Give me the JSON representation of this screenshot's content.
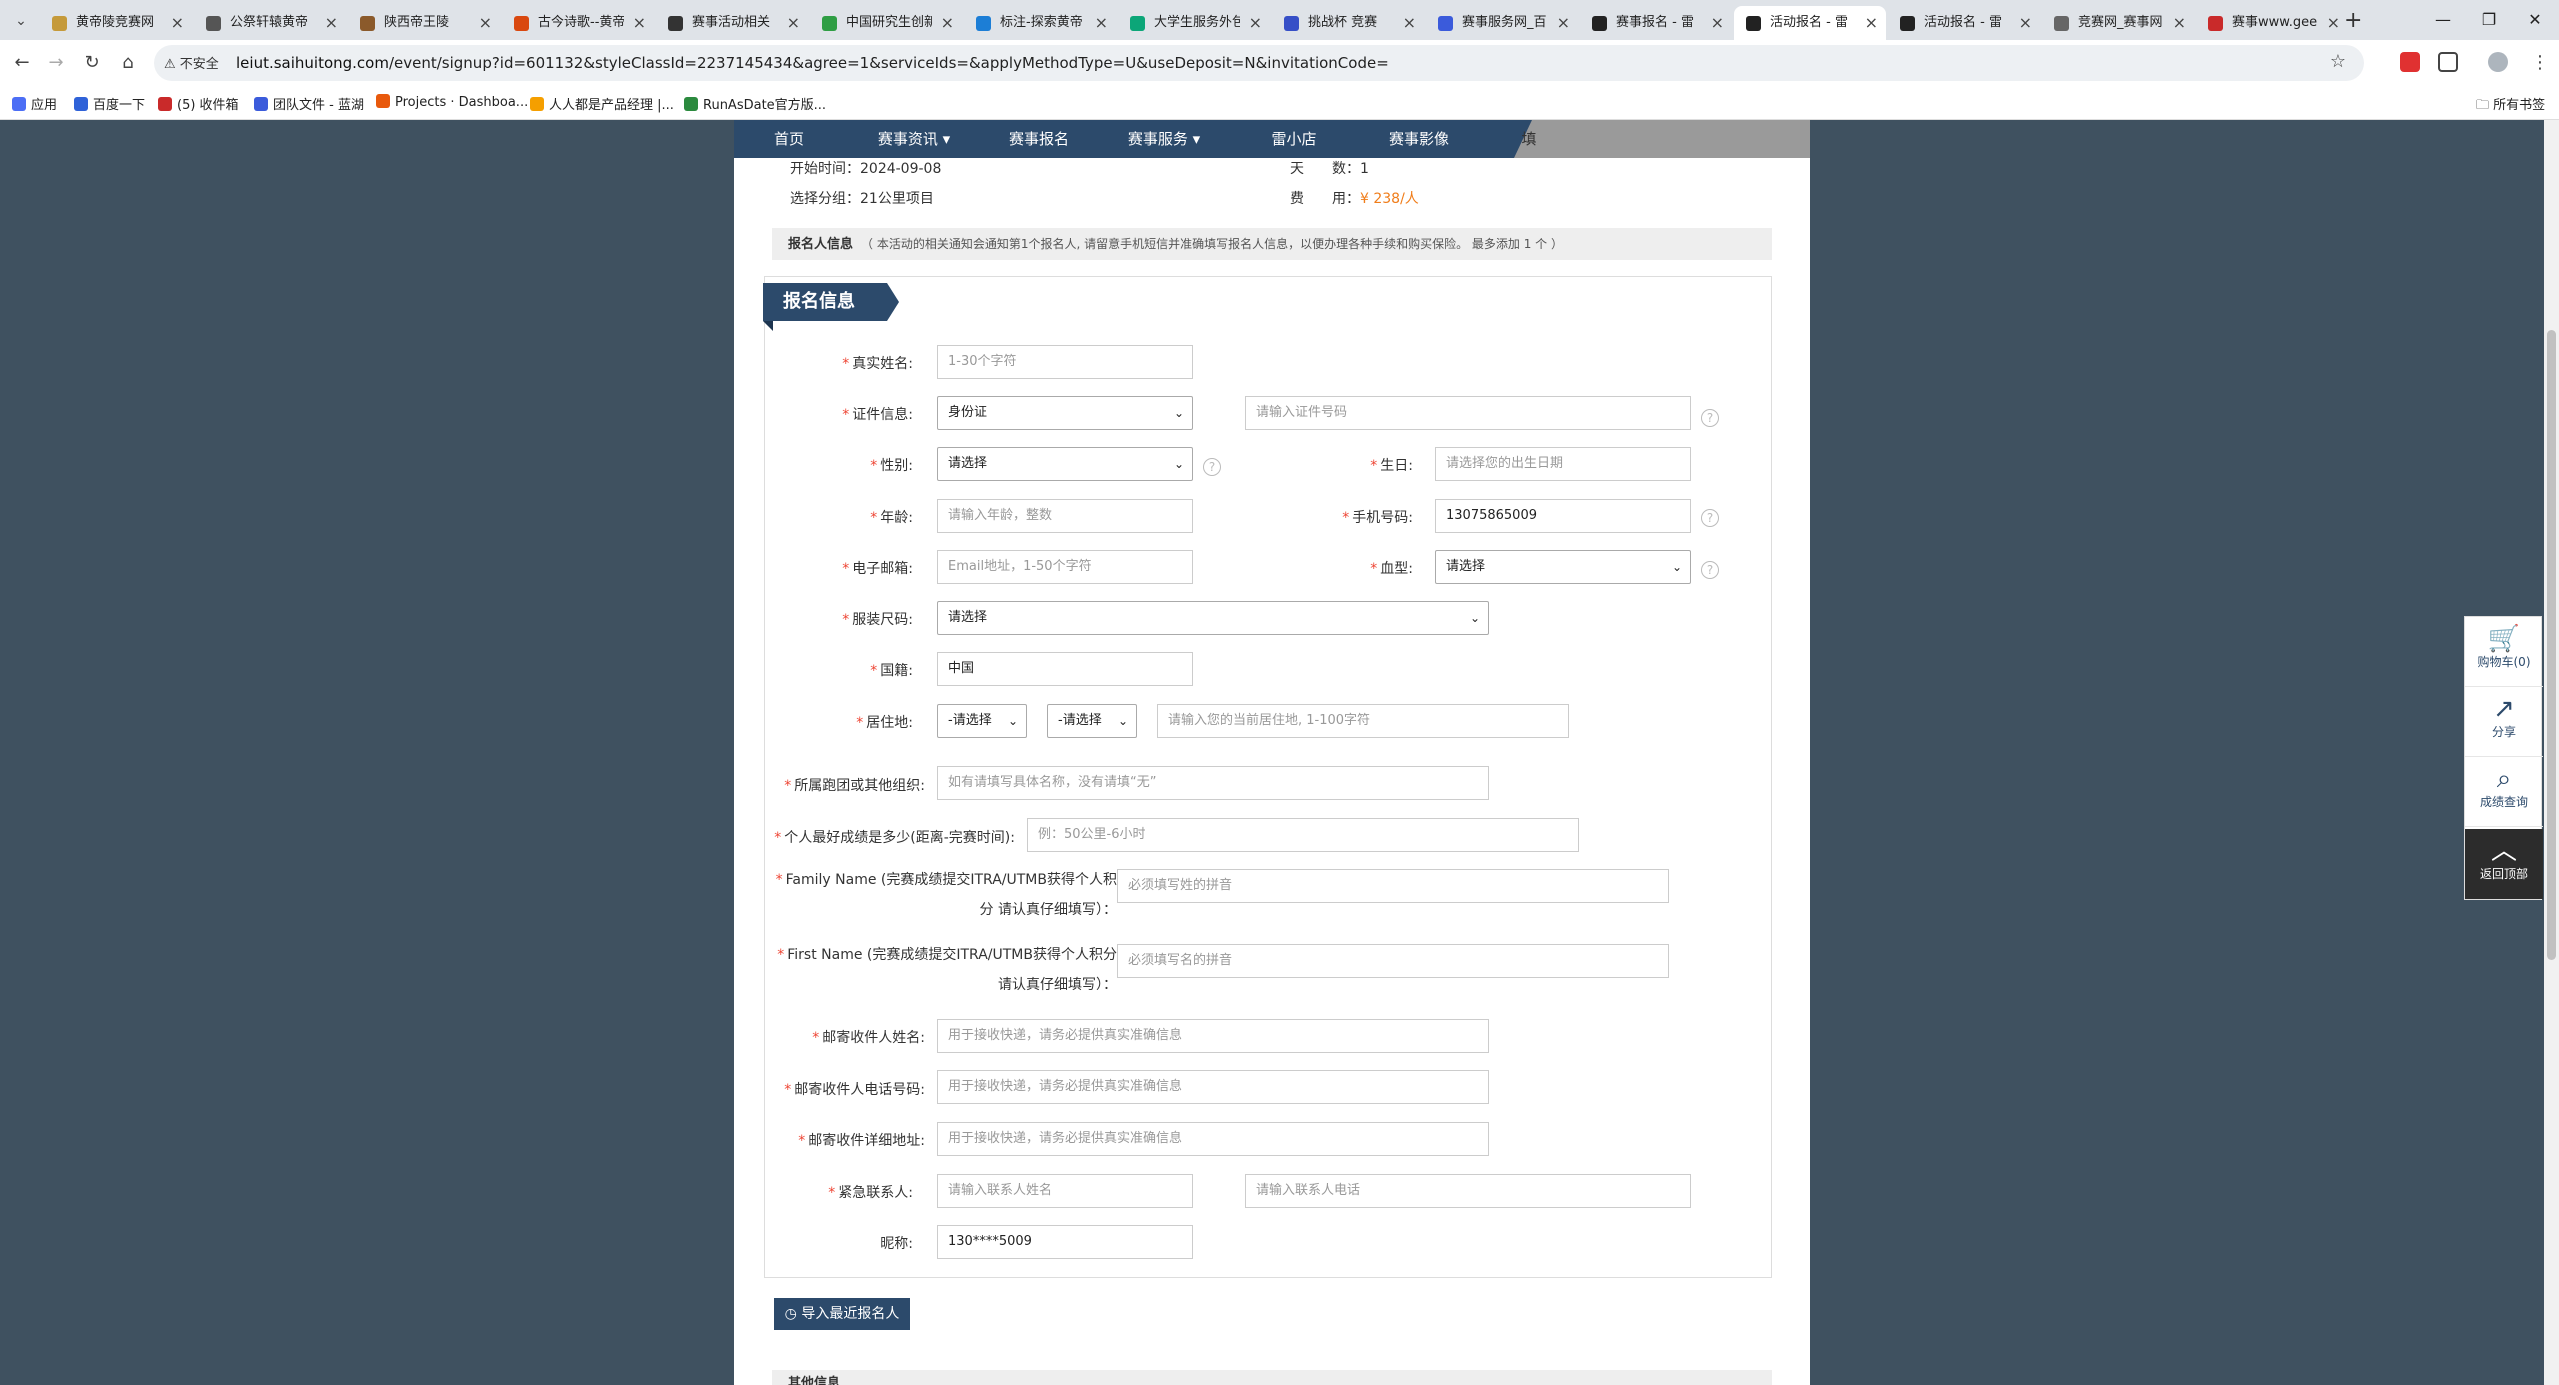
{
  "browser": {
    "tabs": [
      {
        "label": "黄帝陵竞赛网",
        "color": "#c59a3a"
      },
      {
        "label": "公祭轩辕黄帝",
        "color": "#555555"
      },
      {
        "label": "陕西帝王陵",
        "color": "#8b5a2b"
      },
      {
        "label": "古今诗歌--黄帝",
        "color": "#d9480f"
      },
      {
        "label": "赛事活动相关",
        "color": "#333333"
      },
      {
        "label": "中国研究生创新",
        "color": "#2f9e44"
      },
      {
        "label": "标注-探索黄帝",
        "color": "#1c7ed6"
      },
      {
        "label": "大学生服务外包",
        "color": "#0ca678"
      },
      {
        "label": "挑战杯 竞赛",
        "color": "#364fc7"
      },
      {
        "label": "赛事服务网_百",
        "color": "#3b5bdb"
      },
      {
        "label": "赛事报名 - 雷",
        "color": "#222222"
      },
      {
        "label": "活动报名 - 雷",
        "color": "#222222"
      },
      {
        "label": "活动报名 - 雷",
        "color": "#222222"
      },
      {
        "label": "竞赛网_赛事网",
        "color": "#666666"
      },
      {
        "label": "赛事www.gee",
        "color": "#c92a2a"
      }
    ],
    "active_tab_index": 11,
    "insecure_label": "不安全",
    "url_host": "leiut.saihuitong.com",
    "url_path": "/event/signup?id=601132&styleClassId=2237145434&agree=1&serviceIds=&applyMethodType=U&useDeposit=N&invitationCode=",
    "bookmarks": [
      {
        "label": "应用",
        "color": "#4c6ef5"
      },
      {
        "label": "百度一下",
        "color": "#2f62d8"
      },
      {
        "label": "(5) 收件箱",
        "color": "#c92a2a"
      },
      {
        "label": "团队文件 - 蓝湖",
        "color": "#3b5bdb"
      },
      {
        "label": "Projects · Dashboa...",
        "color": "#e8590c"
      },
      {
        "label": "人人都是产品经理 |...",
        "color": "#f59f00"
      },
      {
        "label": "RunAsDate官方版...",
        "color": "#2b8a3e"
      }
    ],
    "all_bookmarks": "所有书签"
  },
  "site_nav": {
    "items": [
      "首页",
      "赛事资讯 ▾",
      "赛事报名",
      "赛事服务 ▾",
      "雷小店",
      "赛事影像"
    ],
    "tail_char": "填"
  },
  "event_info": {
    "start_label": "开始时间：",
    "start_value": "2024-09-08",
    "days_label": "天　　数：",
    "days_value": "1",
    "group_label": "选择分组：",
    "group_value": "21公里项目",
    "fee_label": "费　　用：",
    "fee_value": "¥ 238/人"
  },
  "notice": {
    "title": "报名人信息",
    "text": "（ 本活动的相关通知会通知第1个报名人, 请留意手机短信并准确填写报名人信息，以便办理各种手续和购买保险。 最多添加 1 个 ）"
  },
  "form": {
    "title": "报名信息",
    "name_label": "真实姓名:",
    "name_placeholder": "1-30个字符",
    "id_label": "证件信息:",
    "id_type": "身份证",
    "id_number_placeholder": "请输入证件号码",
    "gender_label": "性别:",
    "gender_value": "请选择",
    "birthday_label": "生日:",
    "birthday_placeholder": "请选择您的出生日期",
    "age_label": "年龄:",
    "age_placeholder": "请输入年龄，整数",
    "phone_label": "手机号码:",
    "phone_value": "13075865009",
    "email_label": "电子邮箱:",
    "email_placeholder": "Email地址，1-50个字符",
    "blood_label": "血型:",
    "blood_value": "请选择",
    "size_label": "服装尺码:",
    "size_value": "请选择",
    "nationality_label": "国籍:",
    "nationality_value": "中国",
    "residence_label": "居住地:",
    "province_value": "-请选择",
    "city_value": "-请选择",
    "residence_placeholder": "请输入您的当前居住地, 1-100字符",
    "club_label": "所属跑团或其他组织:",
    "club_placeholder": "如有请填写具体名称，没有请填“无”",
    "best_label": "个人最好成绩是多少(距离-完赛时间):",
    "best_placeholder": "例：50公里-6小时",
    "family_label": "Family Name (完赛成绩提交ITRA/UTMB获得个人积分 请认真仔细填写）：",
    "family_placeholder": "必须填写姓的拼音",
    "first_label": "First Name (完赛成绩提交ITRA/UTMB获得个人积分请认真仔细填写）：",
    "first_placeholder": "必须填写名的拼音",
    "mail_name_label": "邮寄收件人姓名:",
    "mail_name_placeholder": "用于接收快递，请务必提供真实准确信息",
    "mail_phone_label": "邮寄收件人电话号码:",
    "mail_phone_placeholder": "用于接收快递，请务必提供真实准确信息",
    "mail_addr_label": "邮寄收件详细地址:",
    "mail_addr_placeholder": "用于接收快递，请务必提供真实准确信息",
    "emergency_label": "紧急联系人:",
    "emergency_name_placeholder": "请输入联系人姓名",
    "emergency_phone_placeholder": "请输入联系人电话",
    "nickname_label": "昵称:",
    "nickname_value": "130****5009"
  },
  "import_button": "导入最近报名人",
  "other_section": "其他信息",
  "float_toolbar": {
    "cart": "购物车(0)",
    "share": "分享",
    "query": "成绩查询",
    "top": "返回顶部"
  }
}
